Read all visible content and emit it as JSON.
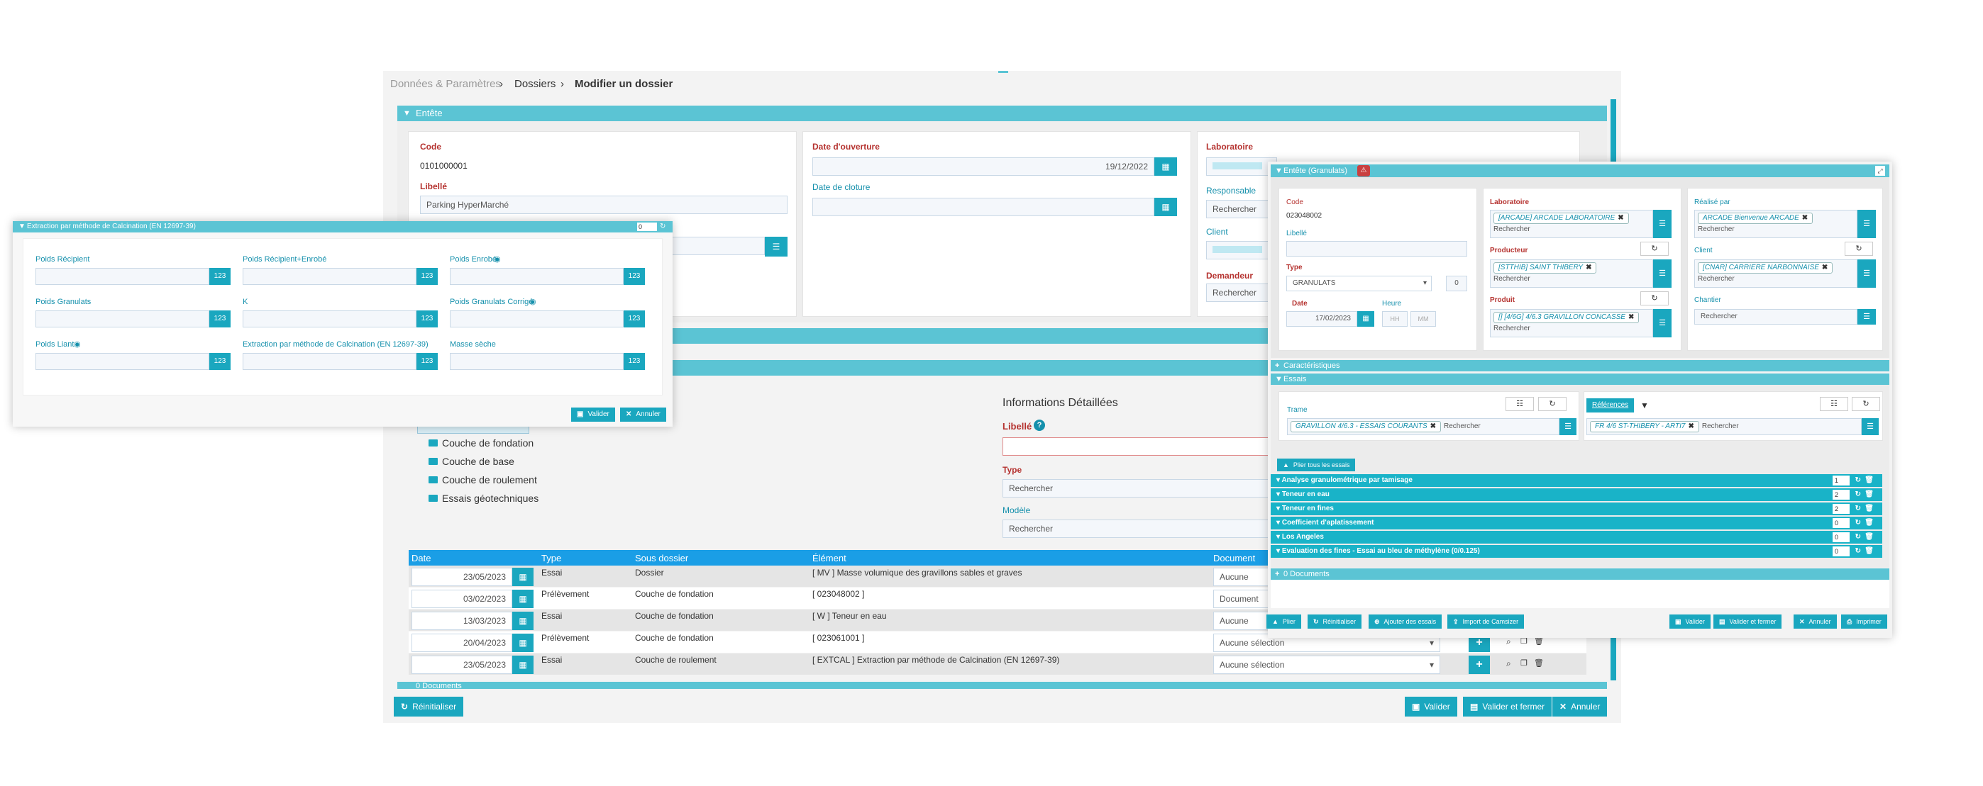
{
  "breadcrumb": {
    "item1": "Données & Paramètres",
    "item2": "Dossiers",
    "item3": "Modifier un dossier"
  },
  "main": {
    "entete_label": "Entête",
    "code_label": "Code",
    "code_value": "0101000001",
    "libelle_label": "Libellé",
    "libelle_value": "Parking HyperMarché",
    "date_ouverture_label": "Date d'ouverture",
    "date_ouverture_value": "19/12/2022",
    "date_cloture_label": "Date de cloture",
    "laboratoire_label": "Laboratoire",
    "responsable_label": "Responsable",
    "client_label": "Client",
    "demandeur_label": "Demandeur",
    "rechercher": "Rechercher",
    "folders": [
      "Couche de fondation",
      "Couche de base",
      "Couche de roulement",
      "Essais géotechniques"
    ],
    "info_title": "Informations Détaillées",
    "info_libelle_label": "Libellé",
    "info_type_label": "Type",
    "info_modele_label": "Modèle",
    "table": {
      "headers": [
        "Date",
        "Type",
        "Sous dossier",
        "Élément",
        "Document"
      ],
      "rows": [
        {
          "date": "23/05/2023",
          "type": "Essai",
          "sous": "Dossier",
          "element": "[ MV ] Masse volumique des gravillons sables et graves",
          "doc": "Aucune sélection"
        },
        {
          "date": "03/02/2023",
          "type": "Prélèvement",
          "sous": "Couche de fondation",
          "element": "[ 023048002 ]",
          "doc": "Document AR"
        },
        {
          "date": "13/03/2023",
          "type": "Essai",
          "sous": "Couche de fondation",
          "element": "[ W ] Teneur en eau",
          "doc": "Aucune sélection"
        },
        {
          "date": "20/04/2023",
          "type": "Prélèvement",
          "sous": "Couche de fondation",
          "element": "[ 023061001 ]",
          "doc": "Aucune sélection"
        },
        {
          "date": "23/05/2023",
          "type": "Essai",
          "sous": "Couche de roulement",
          "element": "[ EXTCAL ] Extraction par méthode de Calcination (EN 12697-39)",
          "doc": "Aucune sélection"
        }
      ]
    },
    "documents_label": "0 Documents",
    "btn_reinit": "Réinitialiser",
    "btn_valider": "Valider",
    "btn_valider_fermer": "Valider et fermer",
    "btn_annuler": "Annuler"
  },
  "calc": {
    "title": "Extraction par méthode de Calcination (EN 12697-39)",
    "counter": "0",
    "fields": [
      {
        "label": "Poids Récipient",
        "eye": false
      },
      {
        "label": "Poids Récipient+Enrobé",
        "eye": false
      },
      {
        "label": "Poids Enrobé",
        "eye": true
      },
      {
        "label": "Poids Granulats",
        "eye": false
      },
      {
        "label": "K",
        "eye": false
      },
      {
        "label": "Poids Granulats Corrigé",
        "eye": true
      },
      {
        "label": "Poids Liant",
        "eye": true
      },
      {
        "label": "Extraction par méthode de Calcination (EN 12697-39)",
        "eye": false
      },
      {
        "label": "Masse sèche",
        "eye": false
      }
    ],
    "num_badge": "123",
    "btn_valider": "Valider",
    "btn_annuler": "Annuler"
  },
  "sample": {
    "entete_label": "Entête (Granulats)",
    "code_label": "Code",
    "code_value": "023048002",
    "libelle_label": "Libellé",
    "type_label": "Type",
    "type_value": "GRANULATS",
    "type_num": "0",
    "date_label": "Date",
    "date_value": "17/02/2023",
    "heure_label": "Heure",
    "hh": "HH",
    "mm": "MM",
    "laboratoire_label": "Laboratoire",
    "laboratoire_tag": "[ARCADE] ARCADE LABORATOIRE",
    "producteur_label": "Producteur",
    "producteur_tag": "[STTHIB] SAINT THIBERY",
    "produit_label": "Produit",
    "produit_tag": "[] [4/6G] 4/6.3 GRAVILLON CONCASSE",
    "realise_label": "Réalisé par",
    "realise_tag": "ARCADE Bienvenue ARCADE",
    "client_label": "Client",
    "client_tag": "[CNAR] CARRIERE NARBONNAISE",
    "chantier_label": "Chantier",
    "rechercher": "Rechercher",
    "caracteristiques_label": "Caractéristiques",
    "essais_label": "Essais",
    "trame_label": "Trame",
    "trame_tag": "GRAVILLON 4/6.3 - ESSAIS COURANTS",
    "references_label": "Références",
    "references_tag": "FR 4/6 ST-THIBERY - ARTI7",
    "plier_tous": "Plier tous les essais",
    "essais": [
      {
        "label": "Analyse granulométrique par tamisage",
        "count": "1"
      },
      {
        "label": "Teneur en eau",
        "count": "2"
      },
      {
        "label": "Teneur en fines",
        "count": "2"
      },
      {
        "label": "Coefficient d'aplatissement",
        "count": "0"
      },
      {
        "label": "Los Angeles",
        "count": "0"
      },
      {
        "label": "Evaluation des fines - Essai au bleu de méthylène (0/0.125)",
        "count": "0"
      }
    ],
    "documents_label": "0 Documents",
    "btn_plier": "Plier",
    "btn_reinit": "Réinitialiser",
    "btn_ajouter": "Ajouter des essais",
    "btn_import": "Import de Camsizer",
    "btn_valider": "Valider",
    "btn_valider_fermer": "Valider et fermer",
    "btn_annuler": "Annuler",
    "btn_imprimer": "Imprimer"
  }
}
